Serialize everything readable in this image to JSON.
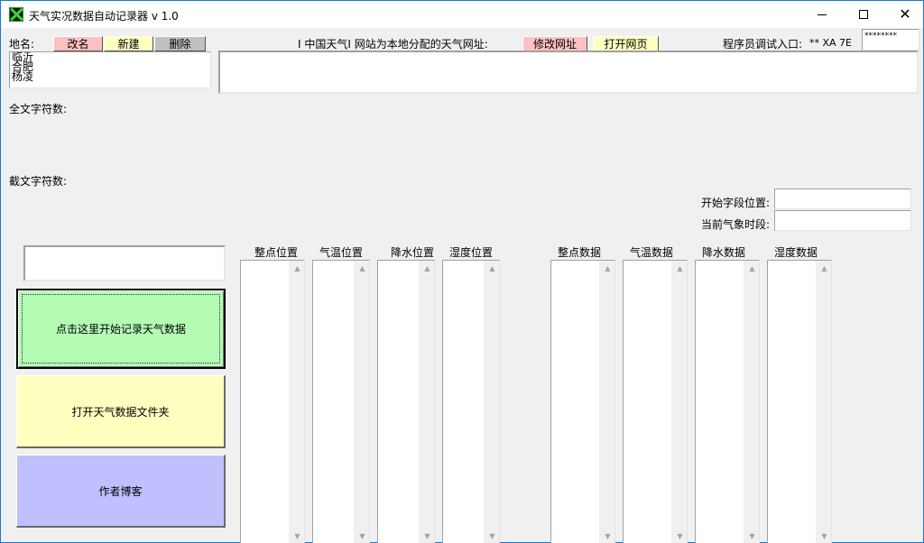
{
  "window": {
    "title": "天气实况数据自动记录器 v 1.0"
  },
  "top": {
    "city_label": "地名:",
    "rename_label": "改名",
    "new_label": "新建",
    "delete_label": "删除",
    "site_text": "I 中国天气I 网站为本地分配的天气网址:",
    "modify_url_label": "修改网址",
    "open_page_label": "打开网页",
    "debug_label": "程序员调试入口:",
    "debug_code": "** XA 7E",
    "debug_password": "********",
    "cities": [
      "临沂",
      "合肥",
      "杨凌"
    ],
    "url_value": ""
  },
  "info": {
    "full_chars_label": "全文字符数:",
    "cut_chars_label": "截文字符数:",
    "start_pos_label": "开始字段位置:",
    "current_period_label": "当前气象时段:"
  },
  "actions": {
    "start_label": "点击这里开始记录天气数据",
    "folder_label": "打开天气数据文件夹",
    "blog_label": "作者博客"
  },
  "columns": {
    "hour_pos": "整点位置",
    "temp_pos": "气温位置",
    "rain_pos": "降水位置",
    "humid_pos": "湿度位置",
    "hour_data": "整点数据",
    "temp_data": "气温数据",
    "rain_data": "降水数据",
    "humid_data": "湿度数据"
  },
  "colors": {
    "rename_bg": "#ffc0c0",
    "new_bg": "#ffffc0",
    "delete_bg": "#c0c0c0",
    "start_bg": "#b4fbb4",
    "folder_bg": "#ffffc0",
    "blog_bg": "#c0c0ff"
  },
  "icons": {
    "app": "app-icon",
    "minimize": "minimize-icon",
    "maximize": "maximize-icon",
    "close": "close-icon"
  }
}
